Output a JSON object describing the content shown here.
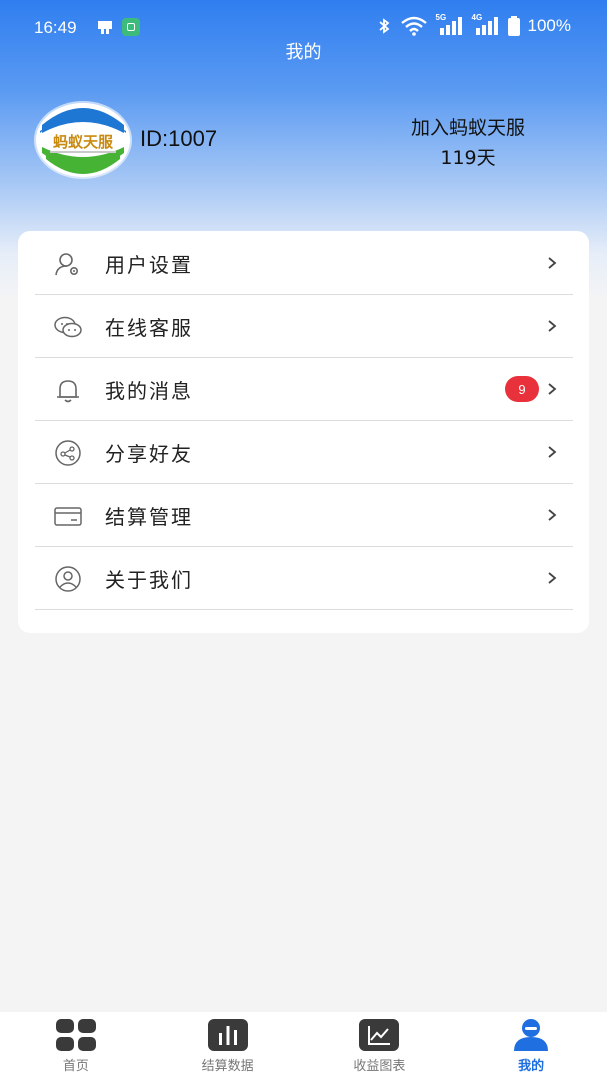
{
  "status_bar": {
    "time": "16:49",
    "network_5g": "5G",
    "network_4g": "4G",
    "battery": "100%"
  },
  "header": {
    "title": "我的"
  },
  "profile": {
    "logo_text": "蚂蚁天服",
    "id_label": "ID:1007",
    "join_label": "加入蚂蚁天服",
    "join_days": "119天"
  },
  "menu": {
    "items": [
      {
        "label": "用户设置",
        "icon": "user-settings-icon"
      },
      {
        "label": "在线客服",
        "icon": "wechat-chat-icon"
      },
      {
        "label": "我的消息",
        "icon": "bell-icon",
        "badge": "9"
      },
      {
        "label": "分享好友",
        "icon": "share-icon"
      },
      {
        "label": "结算管理",
        "icon": "card-icon"
      },
      {
        "label": "关于我们",
        "icon": "about-user-icon"
      }
    ]
  },
  "tabbar": {
    "tabs": [
      {
        "label": "首页",
        "icon": "grid-icon"
      },
      {
        "label": "结算数据",
        "icon": "bar-chart-icon"
      },
      {
        "label": "收益图表",
        "icon": "line-chart-icon"
      },
      {
        "label": "我的",
        "icon": "profile-icon"
      }
    ],
    "active_index": 3
  },
  "colors": {
    "accent": "#1f6fe0",
    "badge": "#e8313a",
    "header_top": "#2f7ef0"
  }
}
